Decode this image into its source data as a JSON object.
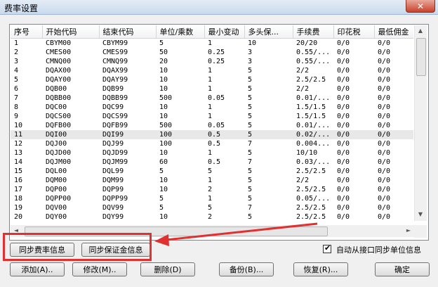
{
  "window": {
    "title": "费率设置",
    "close_glyph": "✕"
  },
  "table": {
    "columns": [
      "序号",
      "开始代码",
      "结束代码",
      "单位/乘数",
      "最小变动",
      "多头保...",
      "手续费",
      "印花税",
      "最低佣金"
    ],
    "selected_row": 10,
    "rows": [
      [
        "1",
        "CBYM00",
        "CBYM99",
        "5",
        "1",
        "10",
        "20/20",
        "0/0",
        "0/0"
      ],
      [
        "2",
        "CMES00",
        "CMES99",
        "50",
        "0.25",
        "3",
        "0.55/...",
        "0/0",
        "0/0"
      ],
      [
        "3",
        "CMNQ00",
        "CMNQ99",
        "20",
        "0.25",
        "3",
        "0.55/...",
        "0/0",
        "0/0"
      ],
      [
        "4",
        "DQAX00",
        "DQAX99",
        "10",
        "1",
        "5",
        "2/2",
        "0/0",
        "0/0"
      ],
      [
        "5",
        "DQAY00",
        "DQAY99",
        "10",
        "1",
        "5",
        "2.5/2.5",
        "0/0",
        "0/0"
      ],
      [
        "6",
        "DQB00",
        "DQB99",
        "10",
        "1",
        "5",
        "2/2",
        "0/0",
        "0/0"
      ],
      [
        "7",
        "DQBB00",
        "DQBB99",
        "500",
        "0.05",
        "5",
        "0.01/...",
        "0/0",
        "0/0"
      ],
      [
        "8",
        "DQC00",
        "DQC99",
        "10",
        "1",
        "5",
        "1.5/1.5",
        "0/0",
        "0/0"
      ],
      [
        "9",
        "DQCS00",
        "DQCS99",
        "10",
        "1",
        "5",
        "1.5/1.5",
        "0/0",
        "0/0"
      ],
      [
        "10",
        "DQFB00",
        "DQFB99",
        "500",
        "0.05",
        "5",
        "0.01/...",
        "0/0",
        "0/0"
      ],
      [
        "11",
        "DQI00",
        "DQI99",
        "100",
        "0.5",
        "5",
        "0.02/...",
        "0/0",
        "0/0"
      ],
      [
        "12",
        "DQJ00",
        "DQJ99",
        "100",
        "0.5",
        "7",
        "0.004...",
        "0/0",
        "0/0"
      ],
      [
        "13",
        "DQJD00",
        "DQJD99",
        "10",
        "1",
        "5",
        "10/10",
        "0/0",
        "0/0"
      ],
      [
        "14",
        "DQJM00",
        "DQJM99",
        "60",
        "0.5",
        "7",
        "0.03/...",
        "0/0",
        "0/0"
      ],
      [
        "15",
        "DQL00",
        "DQL99",
        "5",
        "5",
        "5",
        "2.5/2.5",
        "0/0",
        "0/0"
      ],
      [
        "16",
        "DQM00",
        "DQM99",
        "10",
        "1",
        "5",
        "2/2",
        "0/0",
        "0/0"
      ],
      [
        "17",
        "DQP00",
        "DQP99",
        "10",
        "2",
        "5",
        "2.5/2.5",
        "0/0",
        "0/0"
      ],
      [
        "18",
        "DQPP00",
        "DQPP99",
        "5",
        "1",
        "5",
        "0.05/...",
        "0/0",
        "0/0"
      ],
      [
        "19",
        "DQV00",
        "DQV99",
        "5",
        "5",
        "7",
        "2.5/2.5",
        "0/0",
        "0/0"
      ],
      [
        "20",
        "DQY00",
        "DQY99",
        "10",
        "2",
        "5",
        "2.5/2.5",
        "0/0",
        "0/0"
      ]
    ]
  },
  "scroll_glyphs": {
    "up": "▲",
    "down": "▼",
    "left": "◄",
    "right": "►"
  },
  "sync": {
    "rate_label": "同步费率信息",
    "margin_label": "同步保证金信息",
    "auto_sync_label": "自动从接口同步单位信息",
    "auto_sync_checked": true,
    "check_glyph": "✔"
  },
  "actions": {
    "add": "添加(A)..",
    "edit": "修改(M)..",
    "delete": "删除(D)",
    "backup": "备份(B)...",
    "restore": "恢复(R)...",
    "ok": "确定"
  }
}
